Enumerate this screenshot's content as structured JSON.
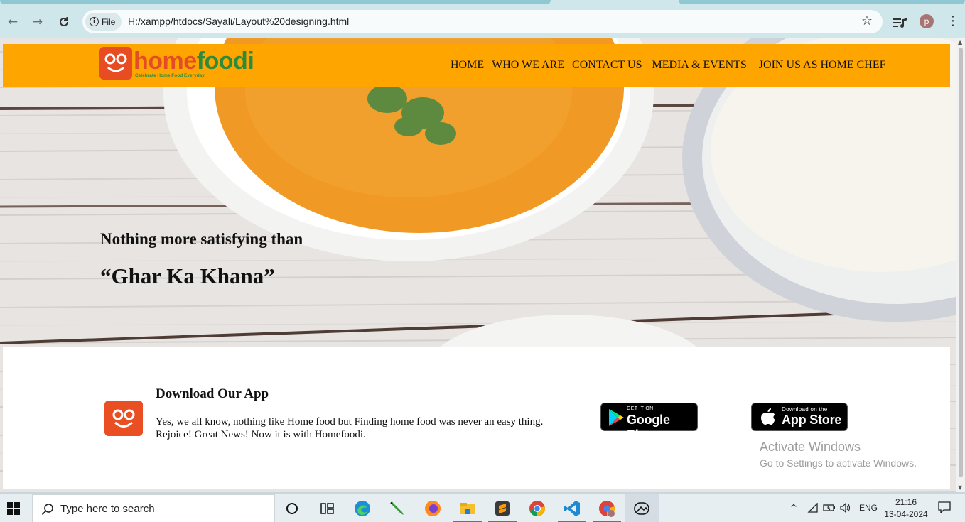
{
  "browser": {
    "back_icon": "arrow-left-icon",
    "forward_icon": "arrow-right-icon",
    "reload_icon": "reload-icon",
    "site_chip_label": "File",
    "url": "H:/xampp/htdocs/Sayali/Layout%20designing.html",
    "profile_initial": "p"
  },
  "site": {
    "logo_home": "home",
    "logo_foodi": "foodi",
    "logo_tagline": "Celebrate Home Food Everyday",
    "nav": [
      "HOME",
      "WHO WE ARE",
      "CONTACT US",
      "MEDIA & EVENTS",
      "JOIN US AS HOME CHEF"
    ],
    "hero_tagline": "Nothing more satisfying than",
    "hero_headline": "“Ghar Ka Khana”",
    "download": {
      "title": "Download Our App",
      "line1": "Yes, we all know, nothing like Home food but Finding home food was never an easy thing.",
      "line2": "Rejoice! Great News! Now it is with Homefoodi.",
      "google_small": "GET IT ON",
      "google_big": "Google Play",
      "apple_small": "Download on the",
      "apple_big": "App Store"
    },
    "colors": {
      "header": "#ffa500",
      "brand_orange": "#e34d26",
      "brand_green": "#2e8b3a"
    }
  },
  "os": {
    "watermark_title": "Activate Windows",
    "watermark_sub": "Go to Settings to activate Windows.",
    "search_placeholder": "Type here to search",
    "language": "ENG",
    "time": "21:16",
    "date": "13-04-2024"
  }
}
